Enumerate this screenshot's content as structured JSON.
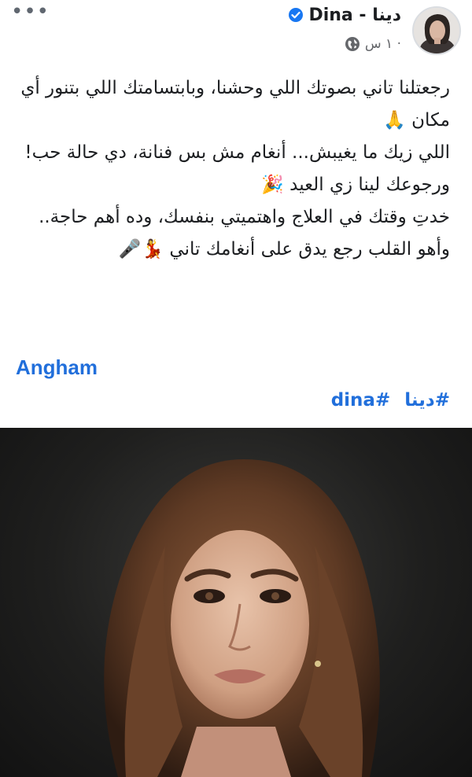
{
  "header": {
    "more_label": "•••",
    "author_name": "Dina - دينا",
    "timestamp": "١ س ·",
    "verified_icon": "verified-badge-icon",
    "privacy_icon": "globe-icon"
  },
  "body": {
    "lines": [
      "رجعتلنا تاني بصوتك اللي وحشنا، وبابتسامتك اللي بتنور أي مكان 🙏",
      "اللي زيك ما يغيبش... أنغام مش بس فنانة، دي حالة حب!",
      "ورجوعك لينا زي العيد 🎉",
      "خدتِ وقتك في العلاج واهتميتي بنفسك، وده أهم حاجة..",
      "وأهو القلب رجع يدق على أنغامك تاني 💃🎤"
    ]
  },
  "mention": "Angham",
  "hashtags": [
    "#دينا",
    "#dina"
  ],
  "colors": {
    "link": "#216fdb",
    "text": "#1c1e21",
    "meta": "#65676b"
  }
}
